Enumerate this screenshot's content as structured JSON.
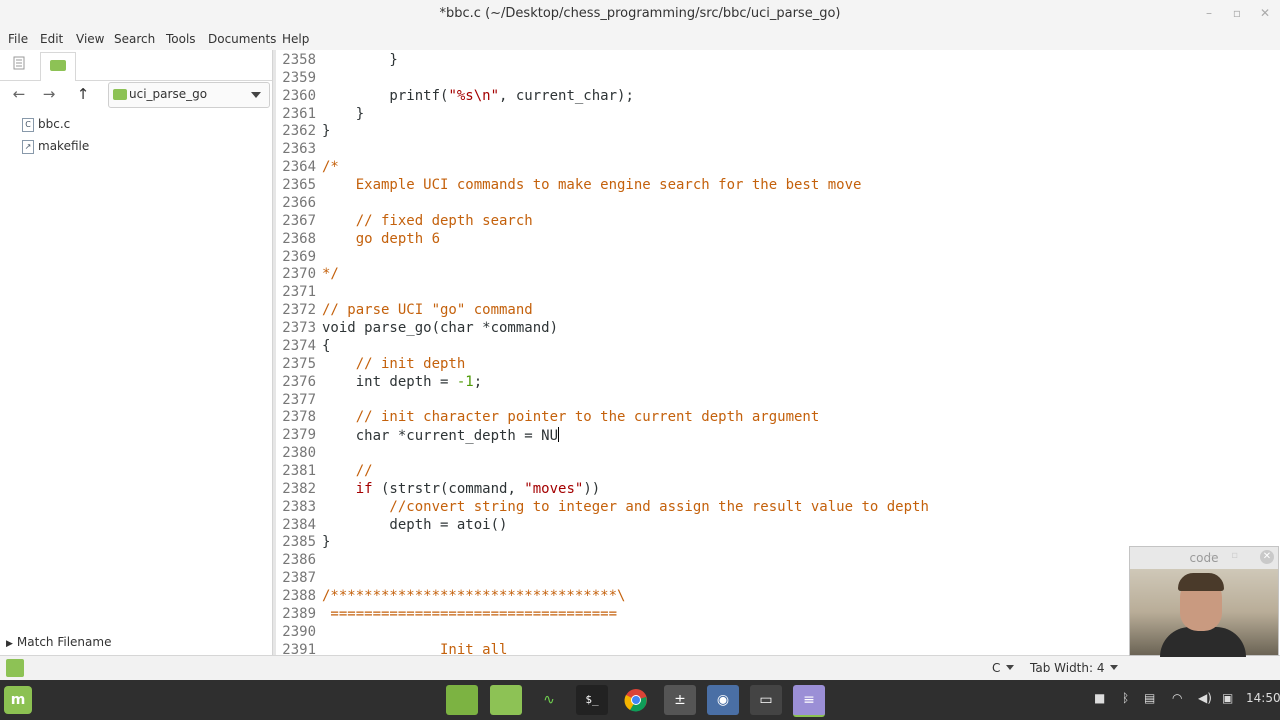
{
  "window": {
    "title": "*bbc.c (~/Desktop/chess_programming/src/bbc/uci_parse_go)"
  },
  "menu": [
    "File",
    "Edit",
    "View",
    "Search",
    "Tools",
    "Documents",
    "Help"
  ],
  "sidebar": {
    "folder": "uci_parse_go",
    "files": [
      {
        "name": "bbc.c",
        "icon": "c-source-file-icon"
      },
      {
        "name": "makefile",
        "icon": "script-file-icon"
      }
    ],
    "match_filename": "Match Filename"
  },
  "editor": {
    "lines": [
      {
        "num": "2358",
        "text": "        }"
      },
      {
        "num": "2359",
        "text": ""
      },
      {
        "num": "2360",
        "text": "        printf(\"%s\\n\", current_char);"
      },
      {
        "num": "2361",
        "text": "    }"
      },
      {
        "num": "2362",
        "text": "}"
      },
      {
        "num": "2363",
        "text": ""
      },
      {
        "num": "2364",
        "text": "/*"
      },
      {
        "num": "2365",
        "text": "    Example UCI commands to make engine search for the best move"
      },
      {
        "num": "2366",
        "text": ""
      },
      {
        "num": "2367",
        "text": "    // fixed depth search"
      },
      {
        "num": "2368",
        "text": "    go depth 6"
      },
      {
        "num": "2369",
        "text": ""
      },
      {
        "num": "2370",
        "text": "*/"
      },
      {
        "num": "2371",
        "text": ""
      },
      {
        "num": "2372",
        "text": "// parse UCI \"go\" command"
      },
      {
        "num": "2373",
        "text": "void parse_go(char *command)"
      },
      {
        "num": "2374",
        "text": "{"
      },
      {
        "num": "2375",
        "text": "    // init depth"
      },
      {
        "num": "2376",
        "text": "    int depth = -1;"
      },
      {
        "num": "2377",
        "text": ""
      },
      {
        "num": "2378",
        "text": "    // init character pointer to the current depth argument"
      },
      {
        "num": "2379",
        "text": "    char *current_depth = NU"
      },
      {
        "num": "2380",
        "text": ""
      },
      {
        "num": "2381",
        "text": "    //"
      },
      {
        "num": "2382",
        "text": "    if (strstr(command, \"moves\"))"
      },
      {
        "num": "2383",
        "text": "        //convert string to integer and assign the result value to depth"
      },
      {
        "num": "2384",
        "text": "        depth = atoi()"
      },
      {
        "num": "2385",
        "text": "}"
      },
      {
        "num": "2386",
        "text": ""
      },
      {
        "num": "2387",
        "text": ""
      },
      {
        "num": "2388",
        "text": "/**********************************\\"
      },
      {
        "num": "2389",
        "text": " =================================="
      },
      {
        "num": "2390",
        "text": ""
      },
      {
        "num": "2391",
        "text": "              Init all"
      }
    ]
  },
  "statusbar": {
    "language": "C",
    "tab_width": "Tab Width: 4"
  },
  "webcam": {
    "title": "code"
  },
  "taskbar": {
    "clock": "14:50"
  }
}
